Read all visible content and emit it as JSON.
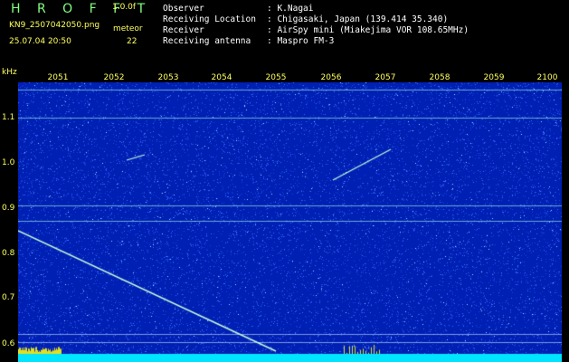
{
  "header": {
    "app_title": "H R O F F T",
    "version": "1.0.0f",
    "filename": "KN9_2507042050.png",
    "mode": "meteor",
    "datetime": "25.07.04 20:50",
    "count": "22"
  },
  "info": {
    "observer_label": "Observer",
    "observer_value": ": K.Nagai",
    "location_label": "Receiving Location",
    "location_value": ": Chigasaki, Japan (139.414 35.340)",
    "receiver_label": "Receiver",
    "receiver_value": ": AirSpy mini (Miakejima VOR 108.65MHz)",
    "antenna_label": "Receiving antenna",
    "antenna_value": ": Maspro FM-3"
  },
  "axis": {
    "y_unit": "kHz",
    "x_ticks": [
      "2051",
      "2052",
      "2053",
      "2054",
      "2055",
      "2056",
      "2057",
      "2058",
      "2059",
      "2100"
    ],
    "y_ticks": [
      "1.1",
      "1.0",
      "0.9",
      "0.8",
      "0.7",
      "0.6"
    ]
  },
  "colors": {
    "background": "#001fb3",
    "noise": "#3a6cff",
    "signal": "#c8ffd8",
    "baseline": "#00e5ff",
    "label": "#ffff60"
  }
}
